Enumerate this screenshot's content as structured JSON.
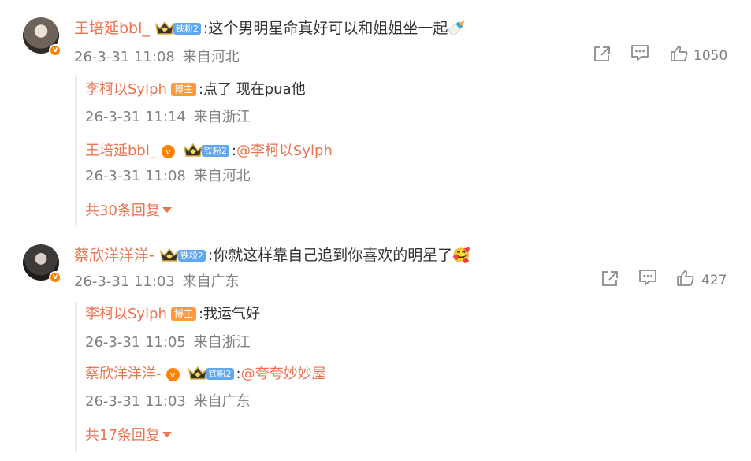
{
  "comments": [
    {
      "username": "王培延bbl_",
      "fan_badge": "铁粉2",
      "text": "这个男明星命真好可以和姐姐坐一起",
      "emoji": "🍼",
      "time": "26-3-31 11:08",
      "location": "来自河北",
      "likes": "1050",
      "replies": [
        {
          "username": "李柯以Sylph",
          "badge": "博主",
          "text": "点了 现在pua他",
          "time": "26-3-31 11:14",
          "location": "来自浙江"
        },
        {
          "username": "王培延bbl_",
          "fan_badge": "铁粉2",
          "mention": "@李柯以Sylph",
          "time": "26-3-31 11:08",
          "location": "来自河北"
        }
      ],
      "more_label": "共30条回复"
    },
    {
      "username": "蔡欣洋洋洋-",
      "fan_badge": "铁粉2",
      "text": "你就这样靠自己追到你喜欢的明星了",
      "emoji": "🥰",
      "time": "26-3-31 11:03",
      "location": "来自广东",
      "likes": "427",
      "replies": [
        {
          "username": "李柯以Sylph",
          "badge": "博主",
          "text": "我运气好",
          "time": "26-3-31 11:05",
          "location": "来自浙江"
        },
        {
          "username": "蔡欣洋洋洋-",
          "fan_badge": "铁粉2",
          "mention": "@夸夸妙妙屋",
          "time": "26-3-31 11:03",
          "location": "来自广东"
        }
      ],
      "more_label": "共17条回复"
    }
  ],
  "colors": {
    "accent": "#eb7350",
    "meta": "#808080",
    "fan_badge": "#5fa8f0",
    "host_badge": "#ff9a3c",
    "verified": "#ff8200"
  },
  "icons": [
    "share-icon",
    "comment-icon",
    "like-icon",
    "verified-icon",
    "crown-icon",
    "caret-down-icon"
  ]
}
